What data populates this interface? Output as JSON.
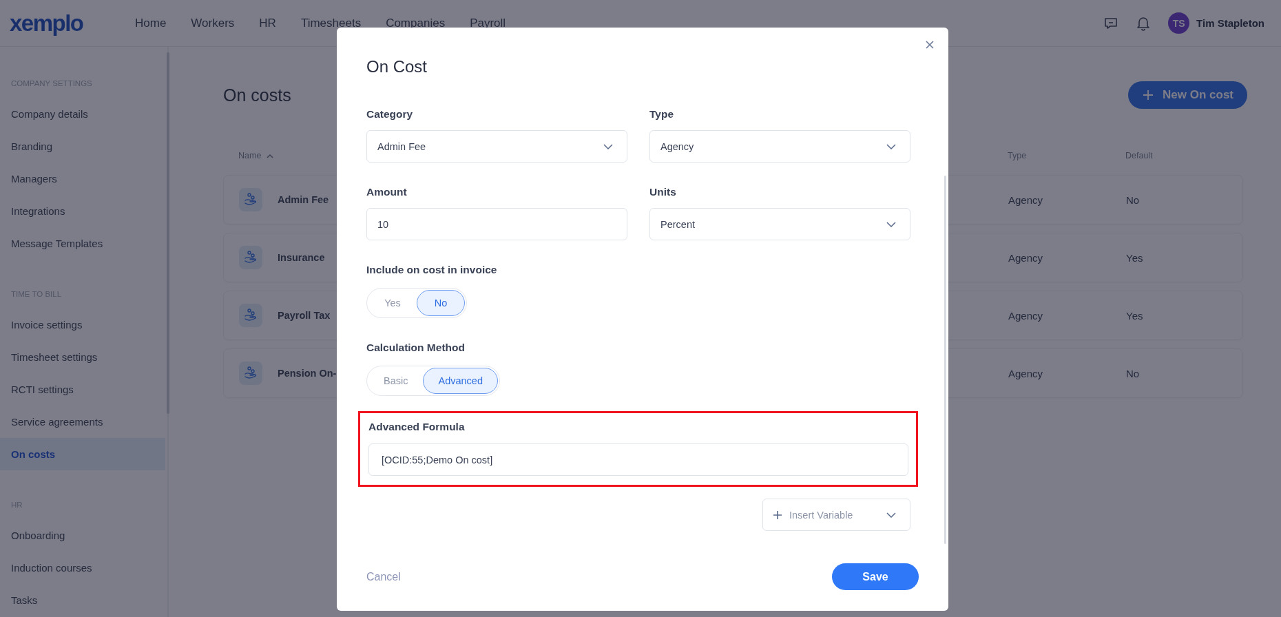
{
  "app": {
    "logo": "xemplo",
    "nav": [
      "Home",
      "Workers",
      "HR",
      "Timesheets",
      "Companies",
      "Payroll"
    ],
    "user": {
      "initials": "TS",
      "name": "Tim Stapleton"
    }
  },
  "sidebar": {
    "sections": [
      {
        "heading": "COMPANY SETTINGS",
        "items": [
          {
            "label": "Company details",
            "selected": false
          },
          {
            "label": "Branding",
            "selected": false
          },
          {
            "label": "Managers",
            "selected": false
          },
          {
            "label": "Integrations",
            "selected": false
          },
          {
            "label": "Message Templates",
            "selected": false
          }
        ]
      },
      {
        "heading": "TIME TO BILL",
        "items": [
          {
            "label": "Invoice settings",
            "selected": false
          },
          {
            "label": "Timesheet settings",
            "selected": false
          },
          {
            "label": "RCTI settings",
            "selected": false
          },
          {
            "label": "Service agreements",
            "selected": false
          },
          {
            "label": "On costs",
            "selected": true
          }
        ]
      },
      {
        "heading": "HR",
        "items": [
          {
            "label": "Onboarding",
            "selected": false
          },
          {
            "label": "Induction courses",
            "selected": false
          },
          {
            "label": "Tasks",
            "selected": false
          }
        ]
      }
    ]
  },
  "page": {
    "title": "On costs",
    "new_button": "New On cost",
    "table": {
      "columns": [
        {
          "label": "Name",
          "sorted": true
        },
        {
          "label": "Type",
          "sorted": false
        },
        {
          "label": "Default",
          "sorted": false
        }
      ],
      "rows": [
        {
          "name": "Admin Fee",
          "type": "Agency",
          "default": "No"
        },
        {
          "name": "Insurance",
          "type": "Agency",
          "default": "Yes"
        },
        {
          "name": "Payroll Tax",
          "type": "Agency",
          "default": "Yes"
        },
        {
          "name": "Pension On-",
          "type": "Agency",
          "default": "No"
        }
      ]
    }
  },
  "modal": {
    "title": "On Cost",
    "fields": [
      {
        "kind": "select",
        "label": "Category",
        "value": "Admin Fee"
      },
      {
        "kind": "select",
        "label": "Type",
        "value": "Agency"
      },
      {
        "kind": "input",
        "label": "Amount",
        "value": "10"
      },
      {
        "kind": "select",
        "label": "Units",
        "value": "Percent"
      }
    ],
    "toggles": [
      {
        "label": "Include on cost in invoice",
        "options": [
          {
            "label": "Yes",
            "selected": false
          },
          {
            "label": "No",
            "selected": true
          }
        ]
      },
      {
        "label": "Calculation Method",
        "options": [
          {
            "label": "Basic",
            "selected": false
          },
          {
            "label": "Advanced",
            "selected": true
          }
        ]
      }
    ],
    "formula": {
      "label": "Advanced Formula",
      "value": "[OCID:55;Demo On cost]",
      "highlighted": true
    },
    "insert_variable": "Insert Variable",
    "cancel": "Cancel",
    "save": "Save"
  }
}
